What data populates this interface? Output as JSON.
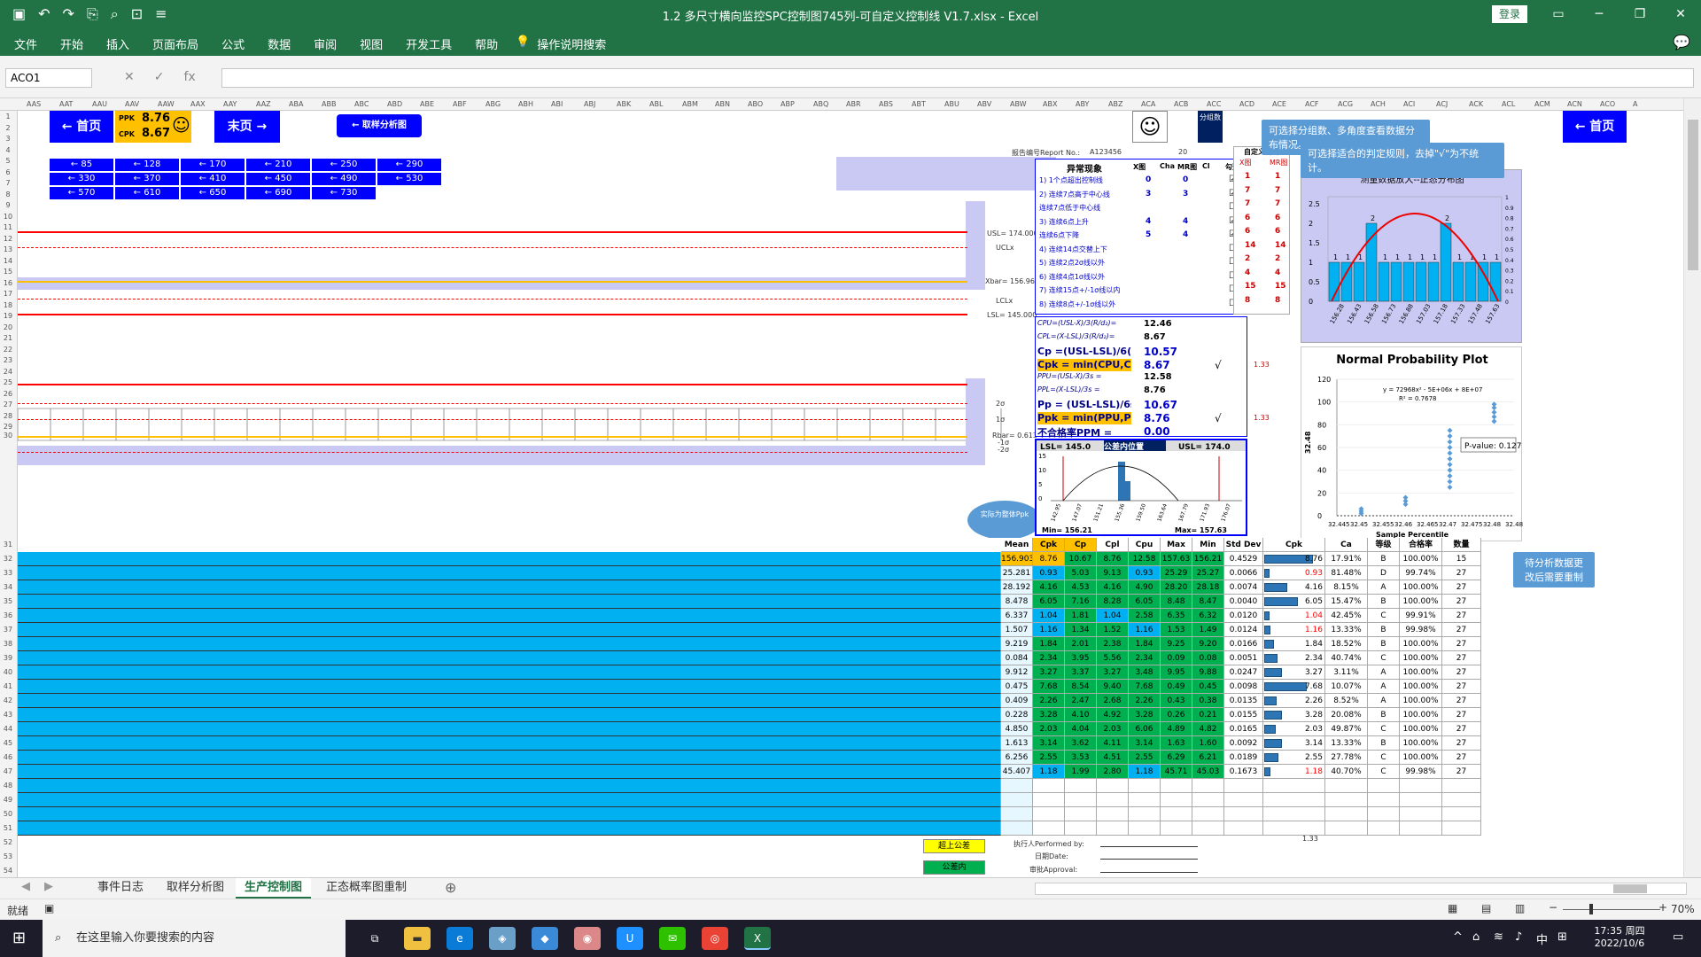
{
  "app": {
    "title": "1.2 多尺寸横向监控SPC控制图745列-可自定义控制线 V1.7.xlsx  -  Excel",
    "login": "登录"
  },
  "ribbon": {
    "tabs": [
      "文件",
      "开始",
      "插入",
      "页面布局",
      "公式",
      "数据",
      "审阅",
      "视图",
      "开发工具",
      "帮助"
    ],
    "search": "操作说明搜索"
  },
  "formula": {
    "namebox": "ACO1",
    "fx": "fx"
  },
  "columns": [
    "AAS",
    "AAT",
    "AAU",
    "AAV",
    "AAW",
    "AAX",
    "AAY",
    "AAZ",
    "ABA",
    "ABB",
    "ABC",
    "ABD",
    "ABE",
    "ABF",
    "ABG",
    "ABH",
    "ABI",
    "ABJ",
    "ABK",
    "ABL",
    "ABM",
    "ABN",
    "ABO",
    "ABP",
    "ABQ",
    "ABR",
    "ABS",
    "ABT",
    "ABU",
    "ABV",
    "ABW",
    "ABX",
    "ABY",
    "ABZ",
    "ACA",
    "ACB",
    "ACC",
    "ACD",
    "ACE",
    "ACF",
    "ACG",
    "ACH",
    "ACI",
    "ACJ",
    "ACK",
    "ACL",
    "ACM",
    "ACN",
    "ACO",
    "A"
  ],
  "nav": {
    "home": "← 首页",
    "end": "末页 →",
    "sample": "← 取样分析图",
    "home2": "← 首页",
    "ppk_label": "PPK",
    "ppk": "8.76",
    "cpk_label": "CPK",
    "cpk": "8.67",
    "smiley": "☺"
  },
  "jumps": [
    "← 85",
    "← 128",
    "← 170",
    "← 210",
    "← 250",
    "← 290",
    "← 330",
    "← 370",
    "← 410",
    "← 450",
    "← 490",
    "← 530",
    "← 570",
    "← 610",
    "← 650",
    "← 690",
    "← 730"
  ],
  "report": {
    "label": "报告编号Report No.:",
    "no": "A123456",
    "n": "20",
    "fen": "分组数"
  },
  "callouts": [
    "可选择分组数、多角度查看数据分布情况。",
    "可选择适合的判定规则，去掉\"√\"为不统计。",
    "待分析数据更改后需要重制"
  ],
  "chart_labels": {
    "usl": "USL= 174.000",
    "uclx": "UCLx",
    "xbar": "Xbar= 156.9698",
    "lclx": "LCLx",
    "lsl": "LSL= 145.000",
    "s2": "2σ",
    "s1": "1σ",
    "rbar": "Rbar= 0.613",
    "m1": "-1σ",
    "m2": "-2σ",
    "bubble": "实际为整体Ppk"
  },
  "rules": {
    "title": "异常现象",
    "cols": [
      "X图",
      "Cha",
      "MR图",
      "Cl",
      "勾选"
    ],
    "items": [
      {
        "t": "1) 1个点超出控制线",
        "x": "0",
        "m": "0",
        "c": "☑"
      },
      {
        "t": "2) 连续7点高于中心线",
        "x": "3",
        "m": "3",
        "c": "☑"
      },
      {
        "t": "连续7点低于中心线",
        "x": "",
        "m": "",
        "c": "☐"
      },
      {
        "t": "3) 连续6点上升",
        "x": "4",
        "m": "4",
        "c": "☑"
      },
      {
        "t": "连续6点下降",
        "x": "5",
        "m": "4",
        "c": "☑"
      },
      {
        "t": "4) 连续14点交替上下",
        "x": "",
        "m": "",
        "c": "☐"
      },
      {
        "t": "5) 连续2点2σ线以外",
        "x": "",
        "m": "",
        "c": "☐"
      },
      {
        "t": "6) 连续4点1σ线以外",
        "x": "",
        "m": "",
        "c": "☐"
      },
      {
        "t": "7) 连续15点+/-1σ线以内",
        "x": "",
        "m": "",
        "c": "☐"
      },
      {
        "t": "8) 连续8点+/-1σ线以外",
        "x": "",
        "m": "",
        "c": "☐"
      }
    ]
  },
  "rules2": {
    "title": "自定义判断",
    "cols": [
      "X图",
      "MR图"
    ],
    "rows": [
      [
        "1",
        "1"
      ],
      [
        "7",
        "7"
      ],
      [
        "7",
        "7"
      ],
      [
        "6",
        "6"
      ],
      [
        "6",
        "6"
      ],
      [
        "14",
        "14"
      ],
      [
        "2",
        "2"
      ],
      [
        "4",
        "4"
      ],
      [
        "15",
        "15"
      ],
      [
        "8",
        "8"
      ]
    ]
  },
  "capability": [
    {
      "f": "CPU=(USL-X̄)/3(R̄/d₂)=",
      "v": "12.46",
      "b": false
    },
    {
      "f": "CPL=(X̄-LSL)/3(R̄/d₂)=",
      "v": "8.67",
      "b": false
    },
    {
      "f": "Cp =(USL-LSL)/6(R̄/d₂)=",
      "v": "10.57",
      "b": true
    },
    {
      "f": "Cpk = min(CPU,CPL)=",
      "v": "8.67",
      "b": true,
      "k": "√",
      "t": "1.33"
    },
    {
      "f": "PPU=(USL-X̄)/3s =",
      "v": "12.58",
      "b": false
    },
    {
      "f": "PPL=(X̄-LSL)/3s =",
      "v": "8.76",
      "b": false
    },
    {
      "f": "Pp = (USL-LSL)/6s =",
      "v": "10.67",
      "b": true
    },
    {
      "f": "Ppk = min(PPU,PPL) =",
      "v": "8.76",
      "b": true,
      "k": "√",
      "t": "1.33"
    },
    {
      "f": "不合格率PPM =",
      "v": "0.00",
      "b": true
    }
  ],
  "mini": {
    "lsl": "LSL= 145.0",
    "mid": "公差内位置",
    "usl": "USL= 174.0",
    "min": "Min= 156.21",
    "max": "Max= 157.63",
    "yticks": [
      "15",
      "10",
      "5",
      "0"
    ],
    "xticks": [
      "142.95",
      "147.07",
      "151.21",
      "155.36",
      "159.50",
      "163.64",
      "167.79",
      "171.93",
      "176.07"
    ]
  },
  "hist": {
    "title": "测量数据放大--正态分布图",
    "bars": [
      1,
      1,
      1,
      2,
      1,
      1,
      1,
      1,
      1,
      2,
      1,
      1,
      1,
      1
    ],
    "labels": [
      "156.28",
      "156.43",
      "156.58",
      "156.73",
      "156.88",
      "157.03",
      "157.18",
      "157.33",
      "157.48",
      "157.63"
    ],
    "yl": [
      "2.5",
      "2",
      "1.5",
      "1",
      "0.5",
      "0"
    ],
    "yr": [
      "1",
      "0.9",
      "0.8",
      "0.7",
      "0.6",
      "0.5",
      "0.4",
      "0.3",
      "0.2",
      "0.1",
      "0"
    ]
  },
  "npp": {
    "title": "Normal Probability Plot",
    "eq": "y = 72968x² - 5E+06x + 8E+07",
    "r2": "R² = 0.7678",
    "pv": "P-value: 0.127",
    "xl": "Sample Percentile",
    "yl": "32.48",
    "yt": [
      "120",
      "100",
      "80",
      "60",
      "40",
      "20",
      "0"
    ],
    "xt": [
      "32.445",
      "32.45",
      "32.455",
      "32.46",
      "32.465",
      "32.47",
      "32.475",
      "32.48",
      "32.485"
    ],
    "pts": [
      [
        32.4505,
        2
      ],
      [
        32.4505,
        4
      ],
      [
        32.4505,
        6
      ],
      [
        32.4605,
        10
      ],
      [
        32.4605,
        13
      ],
      [
        32.4605,
        16
      ],
      [
        32.4705,
        25
      ],
      [
        32.4705,
        30
      ],
      [
        32.4705,
        35
      ],
      [
        32.4705,
        40
      ],
      [
        32.4705,
        45
      ],
      [
        32.4705,
        50
      ],
      [
        32.4705,
        55
      ],
      [
        32.4705,
        60
      ],
      [
        32.4705,
        65
      ],
      [
        32.4705,
        70
      ],
      [
        32.4705,
        75
      ],
      [
        32.4805,
        83
      ],
      [
        32.4805,
        87
      ],
      [
        32.4805,
        91
      ],
      [
        32.4805,
        95
      ],
      [
        32.4805,
        98
      ]
    ]
  },
  "table": {
    "headers": [
      "Mean",
      "Cpk",
      "Cp",
      "Cpl",
      "Cpu",
      "Max",
      "Min",
      "Std Dev",
      "Cpk",
      "Ca",
      "等级",
      "合格率",
      "数量"
    ],
    "rows": [
      [
        "156.903",
        "8.76",
        "10.67",
        "8.76",
        "12.58",
        "157.63",
        "156.21",
        "0.4529",
        "8.76",
        "17.91%",
        "B",
        "100.00%",
        "15"
      ],
      [
        "25.281",
        "0.93",
        "5.03",
        "9.13",
        "0.93",
        "25.29",
        "25.27",
        "0.0066",
        "0.93",
        "81.48%",
        "D",
        "99.74%",
        "27"
      ],
      [
        "28.192",
        "4.16",
        "4.53",
        "4.16",
        "4.90",
        "28.20",
        "28.18",
        "0.0074",
        "4.16",
        "8.15%",
        "A",
        "100.00%",
        "27"
      ],
      [
        "8.478",
        "6.05",
        "7.16",
        "8.28",
        "6.05",
        "8.48",
        "8.47",
        "0.0040",
        "6.05",
        "15.47%",
        "B",
        "100.00%",
        "27"
      ],
      [
        "6.337",
        "1.04",
        "1.81",
        "1.04",
        "2.58",
        "6.35",
        "6.32",
        "0.0120",
        "1.04",
        "42.45%",
        "C",
        "99.91%",
        "27"
      ],
      [
        "1.507",
        "1.16",
        "1.34",
        "1.52",
        "1.16",
        "1.53",
        "1.49",
        "0.0124",
        "1.16",
        "13.33%",
        "B",
        "99.98%",
        "27"
      ],
      [
        "9.219",
        "1.84",
        "2.01",
        "2.38",
        "1.84",
        "9.25",
        "9.20",
        "0.0166",
        "1.84",
        "18.52%",
        "B",
        "100.00%",
        "27"
      ],
      [
        "0.084",
        "2.34",
        "3.95",
        "5.56",
        "2.34",
        "0.09",
        "0.08",
        "0.0051",
        "2.34",
        "40.74%",
        "C",
        "100.00%",
        "27"
      ],
      [
        "9.912",
        "3.27",
        "3.37",
        "3.27",
        "3.48",
        "9.95",
        "9.88",
        "0.0247",
        "3.27",
        "3.11%",
        "A",
        "100.00%",
        "27"
      ],
      [
        "0.475",
        "7.68",
        "8.54",
        "9.40",
        "7.68",
        "0.49",
        "0.45",
        "0.0098",
        "7.68",
        "10.07%",
        "A",
        "100.00%",
        "27"
      ],
      [
        "0.409",
        "2.26",
        "2.47",
        "2.68",
        "2.26",
        "0.43",
        "0.38",
        "0.0135",
        "2.26",
        "8.52%",
        "A",
        "100.00%",
        "27"
      ],
      [
        "0.228",
        "3.28",
        "4.10",
        "4.92",
        "3.28",
        "0.26",
        "0.21",
        "0.0155",
        "3.28",
        "20.08%",
        "B",
        "100.00%",
        "27"
      ],
      [
        "4.850",
        "2.03",
        "4.04",
        "2.03",
        "6.06",
        "4.89",
        "4.82",
        "0.0165",
        "2.03",
        "49.87%",
        "C",
        "100.00%",
        "27"
      ],
      [
        "1.613",
        "3.14",
        "3.62",
        "4.11",
        "3.14",
        "1.63",
        "1.60",
        "0.0092",
        "3.14",
        "13.33%",
        "B",
        "100.00%",
        "27"
      ],
      [
        "6.256",
        "2.55",
        "3.53",
        "4.51",
        "2.55",
        "6.29",
        "6.21",
        "0.0189",
        "2.55",
        "27.78%",
        "C",
        "100.00%",
        "27"
      ],
      [
        "45.407",
        "1.18",
        "1.99",
        "2.80",
        "1.18",
        "45.71",
        "45.03",
        "0.1673",
        "1.18",
        "40.70%",
        "C",
        "99.98%",
        "27"
      ]
    ],
    "foot": "1.33"
  },
  "legend": {
    "over": "超上公差",
    "in": "公差内"
  },
  "sign": {
    "performed": "执行人Performed by:",
    "date": "日期Date:",
    "approval": "审批Approval:"
  },
  "sheets": [
    "事件日志",
    "取样分析图",
    "生产控制图",
    "正态概率图重制"
  ],
  "status": {
    "ready": "就绪",
    "zoom": "70%"
  },
  "taskbar": {
    "search": "在这里输入你要搜索的内容",
    "time": "17:35 周四",
    "date": "2022/10/6",
    "ime": "中"
  },
  "colors": {
    "excel_green": "#217346",
    "nav_blue": "#0000ff",
    "lavender": "#c9c9f4",
    "cyan": "#00b0f0",
    "green": "#00b050",
    "gold": "#ffc000",
    "red": "#ff0000"
  }
}
